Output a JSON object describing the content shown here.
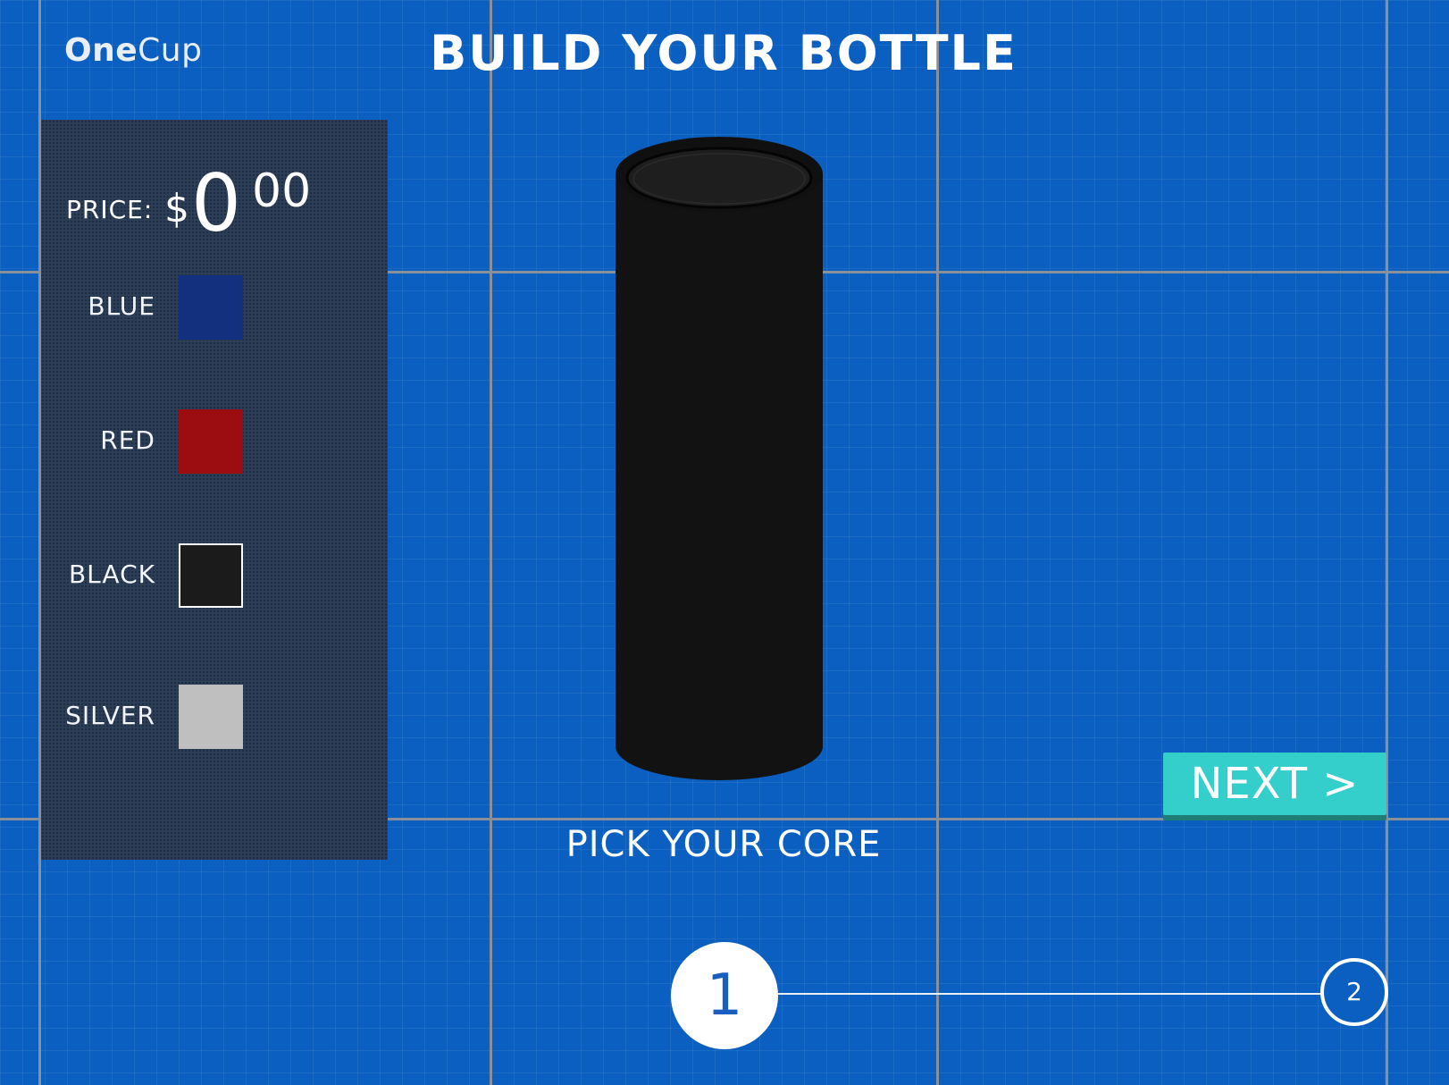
{
  "brand": {
    "bold": "One",
    "light": "Cup"
  },
  "header": {
    "title": "BUILD YOUR BOTTLE"
  },
  "price": {
    "label": "PRICE:",
    "currency": "$",
    "dollars": "0",
    "cents": "00"
  },
  "colors": {
    "items": [
      {
        "label": "BLUE",
        "hex": "#13307f",
        "selected": false
      },
      {
        "label": "RED",
        "hex": "#9b0d10",
        "selected": false
      },
      {
        "label": "BLACK",
        "hex": "#1b1b1b",
        "selected": true
      },
      {
        "label": "SILVER",
        "hex": "#bfbfbf",
        "selected": false
      }
    ]
  },
  "step": {
    "caption": "PICK YOUR CORE",
    "current": "1",
    "next": "2"
  },
  "actions": {
    "next_label": "NEXT >"
  },
  "theme": {
    "background": "#0a5fc0",
    "accent": "#35cfcb",
    "bottle": "#121212"
  }
}
